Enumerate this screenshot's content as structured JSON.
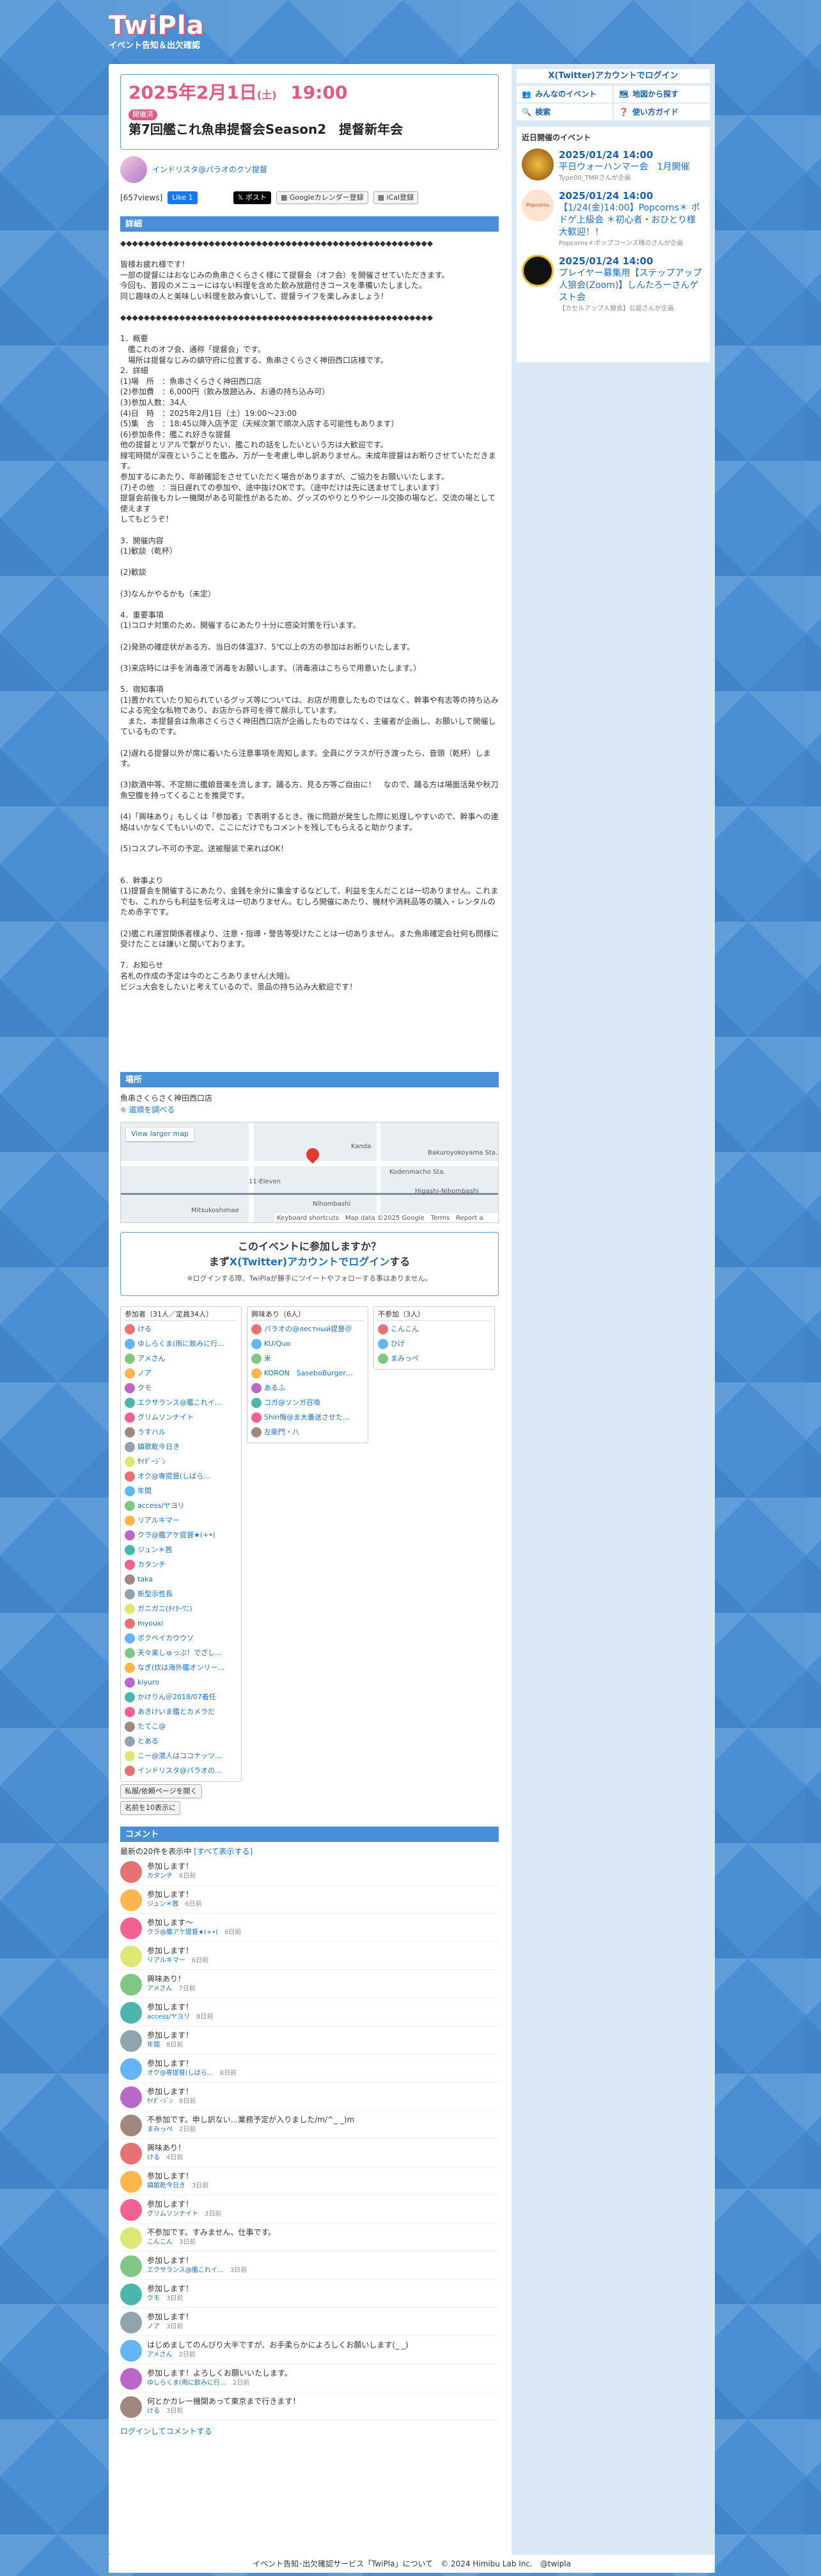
{
  "site": {
    "logo": "TwiPla",
    "tagline": "イベント告知＆出欠確認"
  },
  "event": {
    "date_main": "2025年2月1日",
    "date_dow": "(土)",
    "date_time": "19:00",
    "status": "開催済",
    "title": "第7回艦これ魚串提督会Season2　提督新年会",
    "organizer": "インドリスタ@パラオのクソ提督",
    "views": "[657views]",
    "fb_like": "Like 1",
    "x_post": "ポスト",
    "gcal": "Googleカレンダー登録",
    "ical": "iCal登録"
  },
  "detail": {
    "heading": "詳細",
    "body": "◆◆◆◆◆◆◆◆◆◆◆◆◆◆◆◆◆◆◆◆◆◆◆◆◆◆◆◆◆◆◆◆◆◆◆◆◆◆◆◆◆◆◆◆◆◆◆◆◆◆◆◆◆\n\n皆様お疲れ様です！\n一部の提督にはおなじみの魚串さくらさく様にて提督会（オフ会）を開催させていただきます。\n今回も、普段のメニューにはない料理を含めた飲み放題付きコースを準備いたしました。\n同じ趣味の人と美味しい料理を飲み食いして、提督ライフを楽しみましょう！\n\n◆◆◆◆◆◆◆◆◆◆◆◆◆◆◆◆◆◆◆◆◆◆◆◆◆◆◆◆◆◆◆◆◆◆◆◆◆◆◆◆◆◆◆◆◆◆◆◆◆◆◆◆◆\n\n1．概要\n　艦これのオフ会、通称「提督会」です。\n　場所は提督なじみの鎮守府に位置する、魚串さくらさく神田西口店様です。\n2．詳細\n(1)場　所　：魚串さくらさく神田西口店\n(2)参加費　：6,000円（飲み放題込み、お通の持ち込み可）\n(3)参加人数：34人\n(4)日　時　：2025年2月1日（土）19:00〜23:00\n(5)集　合　：18:45以降入店予定（天候次第で順次入店する可能性もあります）\n(6)参加条件：艦これ好きな提督\n他の提督とリアルで繋がりたい、艦これの話をしたいという方は大歓迎です。\n線宅時間が深夜ということを鑑み、万が一を考慮し申し訳ありません。未成年提督はお断りさせていただきます。\n参加するにあたり、年齢確認をさせていただく場合がありますが、ご協力をお願いいたします。\n(7)その他　：当日遅れての参加や、途中抜けOKです。（途中だけは先に送ませてしまいます）\n提督会前後もカレー機関がある可能性があるため、グッズのやりとりやシール交換の場など、交流の場として使えます\nしてもどうぞ！\n\n3．開催内容\n(1)歓談（乾杯）\n\n(2)歓談\n\n(3)なんかやるかも（未定）\n\n4．重要事項\n(1)コロナ対策のため、開催するにあたり十分に感染対策を行います。\n\n(2)発熱の確症状がある方、当日の体温37．5℃以上の方の参加はお断りいたします。\n\n(3)来店時には手を消毒液で消毒をお願いします。（消毒液はこちらで用意いたします。）\n\n5．宿知事項\n(1)置かれていたり知られているグッズ等については、お店が用意したものではなく、幹事や有志等の持ち込みによる完全な私物であり、お店から許可を得て展示しています。\n　また、本提督会は魚串さくらさく神田西口店が企画したものではなく、主催者が企画し、お願いして開催しているものです。\n\n(2)遅れる提督以外が席に着いたら注意事項を周知します。全員にグラスが行き渡ったら、音頭（乾杯）します。\n\n(3)飲酒中等、不定期に艦娘音楽を流します。踊る方、見る方等ご自由に！　なので、踊る方は場面活発や秋刀魚空腹を持ってくることを推奨です。\n\n(4)「興味あり」もしくは「参加者」で表明するとき、後に問題が発生した際に処理しやすいので、幹事への連絡はいかなくてもいいので、ここにだけでもコメントを残してもらえると助かります。\n\n(5)コスプレ不可の予定。送被服装で来ればOK！\n\n\n6．幹事より\n(1)提督会を開催するにあたり、金銭を余分に集金するなどして、利益を生んだことは一切ありません。これまでも、これからも利益を伝考えは一切ありません。むしろ開催にあたり、機材や消耗品等の購入・レンタルのため赤字です。\n\n(2)艦これ運営関係者様より、注意・指導・警告等受けたことは一切ありません。また魚串確定会社何も問様に受けたことは嫌いと聞いております。\n\n7．お知らせ\n名札の作成の予定は今のところありません(大暗)。\nビジュ大会をしたいと考えているので、景品の持ち込み大歓迎です！"
  },
  "location": {
    "heading": "場所",
    "name": "魚串さくらさく神田西口店",
    "route_link": "道順を調べる",
    "map_view_larger": "View larger map",
    "map_labels": {
      "l1": "Kanda",
      "l2": "Kodenmacho Sta.",
      "l3": "Nihombashi",
      "l4": "Higashi-Nihombashi",
      "l5": "11-Eleven",
      "l6": "Bakuroyokoyama Sta.",
      "l7": "Mitsukoshimae"
    },
    "map_footer": "Keyboard shortcuts　Map data ©2025 Google　Terms　Report a map error"
  },
  "join": {
    "question": "このイベントに参加しますか？",
    "login_prefix": "まず",
    "login_link": "X(Twitter)アカウントでログイン",
    "login_suffix": "する",
    "note": "※ログインする際、TwiPlaが勝手にツイートやフォローする事はありません。"
  },
  "participants": {
    "attend_head": "参加者（31人／定員34人）",
    "attend": [
      "ける",
      "ゆしらくま(雨に飲みに行…",
      "アメさん",
      "ノア",
      "クモ",
      "エクサランス@艦これイ…",
      "グリムソンナイト",
      "うすハル",
      "鎮歌乾今日き",
      "ｻｲﾀﾞｰｼﾞﾝ",
      "オク@専提督(しばら…",
      "年間",
      "access/ヤヨリ",
      "リアルキマー",
      "クラ@艦アケ提督★(+•(",
      "ジュン＊茜",
      "カタンチ",
      "taka",
      "新型示性長",
      "ガニガニ(ﾀｲﾀｰﾜﾆ)",
      "myouxi",
      "ボクベイカウウソ",
      "天々楽しゅっぷ！でざし…",
      "なぎ(炊は海外艦オンリー…",
      "kiyuro",
      "かけりん＠2018/07着任",
      "あきけいま艦とカメラだ",
      "たてこ@",
      "とある",
      "こー@潜人はココナッツ…",
      "インドリスタ@パラオの…"
    ],
    "interested_head": "興味あり（6人）",
    "interested": [
      "パラオの@лестный提督＠",
      "KU/Quo",
      "米",
      "KORON　SaseboBurger…",
      "あるふ",
      "コガ@ソンガ召喚",
      "Shin悔@ま大番送させた…",
      "左衛門・八"
    ],
    "absent_head": "不参加（3人）",
    "absent": [
      "こんこん",
      "ひげ",
      "まみっぺ"
    ],
    "btn_open": "私服/依頼ページを開く",
    "btn_name": "名前を10表示に"
  },
  "comments": {
    "heading": "コメント",
    "summary": "最新の20件を表示中",
    "show_all": "[すべて表示する]",
    "items": [
      {
        "text": "参加します！",
        "user": "カタンチ",
        "ago": "6日前"
      },
      {
        "text": "参加します！",
        "user": "ジュン＊茜",
        "ago": "6日前"
      },
      {
        "text": "参加します〜",
        "user": "クラ@艦アケ提督★(+•(",
        "ago": "6日前"
      },
      {
        "text": "参加します！",
        "user": "リアルキマー",
        "ago": "6日前"
      },
      {
        "text": "興味あり！",
        "user": "アメさん",
        "ago": "7日前"
      },
      {
        "text": "参加します！",
        "user": "access/ヤヨリ",
        "ago": "8日前"
      },
      {
        "text": "参加します！",
        "user": "年間",
        "ago": "8日前"
      },
      {
        "text": "参加します！",
        "user": "オク@専提督(しばら…",
        "ago": "8日前"
      },
      {
        "text": "参加します！",
        "user": "ｻｲﾀﾞｰｼﾞﾝ",
        "ago": "8日前"
      },
      {
        "text": "不参加です。申し訳ない...業務予定が入りました/m/^_ _)m",
        "user": "まみっぺ",
        "ago": "2日前"
      },
      {
        "text": "興味あり！",
        "user": "ける",
        "ago": "4日前"
      },
      {
        "text": "参加します！",
        "user": "鎮歌乾今日き",
        "ago": "3日前"
      },
      {
        "text": "参加します！",
        "user": "グリムソンナイト",
        "ago": "3日前"
      },
      {
        "text": "不参加です。すみません、仕事です。",
        "user": "こんこん",
        "ago": "3日前"
      },
      {
        "text": "参加します！",
        "user": "エクサランス@艦これイ…",
        "ago": "3日前"
      },
      {
        "text": "参加します！",
        "user": "クモ",
        "ago": "3日前"
      },
      {
        "text": "参加します！",
        "user": "ノア",
        "ago": "3日前"
      },
      {
        "text": "はじめましてのんびり大半ですが、お手柔らかによろしくお願いします(_ _)",
        "user": "アメさん",
        "ago": "2日前"
      },
      {
        "text": "参加します！よろしくお願いいたします。",
        "user": "ゆしらくま(雨に飲みに行…",
        "ago": "2日前"
      },
      {
        "text": "何とかカレー機関あって東京まで行きます！",
        "user": "ける",
        "ago": "3日前"
      }
    ],
    "login_to_comment": "ログインしてコメントする"
  },
  "sidebar": {
    "login": "X(Twitter)アカウントでログイン",
    "nav": [
      "みんなのイベント",
      "地図から探す",
      "検索",
      "使い方ガイド"
    ],
    "recent_head": "近日開催のイベント",
    "events": [
      {
        "date": "2025/01/24 14:00",
        "title": "平日ウォーハンマー会　1月開催",
        "meta": "Type00_TMRさんが企画"
      },
      {
        "date": "2025/01/24 14:00",
        "title": "【1/24(金)14:00】Popcorns＊ ポドゲ上級会 ＊初心者・おひとり様大歓迎！！",
        "meta": "Popcorns＊ポップコーンズ様のさんが企画"
      },
      {
        "date": "2025/01/24 14:00",
        "title": "プレイヤー募集用【ステップアップ人狼会(Zoom)】しんたろーさんゲスト会",
        "meta": "【カセルアップ人狼会】公認さんが企画"
      }
    ]
  },
  "footer": {
    "text": "イベント告知･出欠確認サービス「TwiPla」について　© 2024 Himibu Lab Inc.　@twipla"
  },
  "colors": {
    "brand_pink": "#e05a7e",
    "brand_blue": "#4a90d9",
    "link": "#1a6fc4"
  }
}
